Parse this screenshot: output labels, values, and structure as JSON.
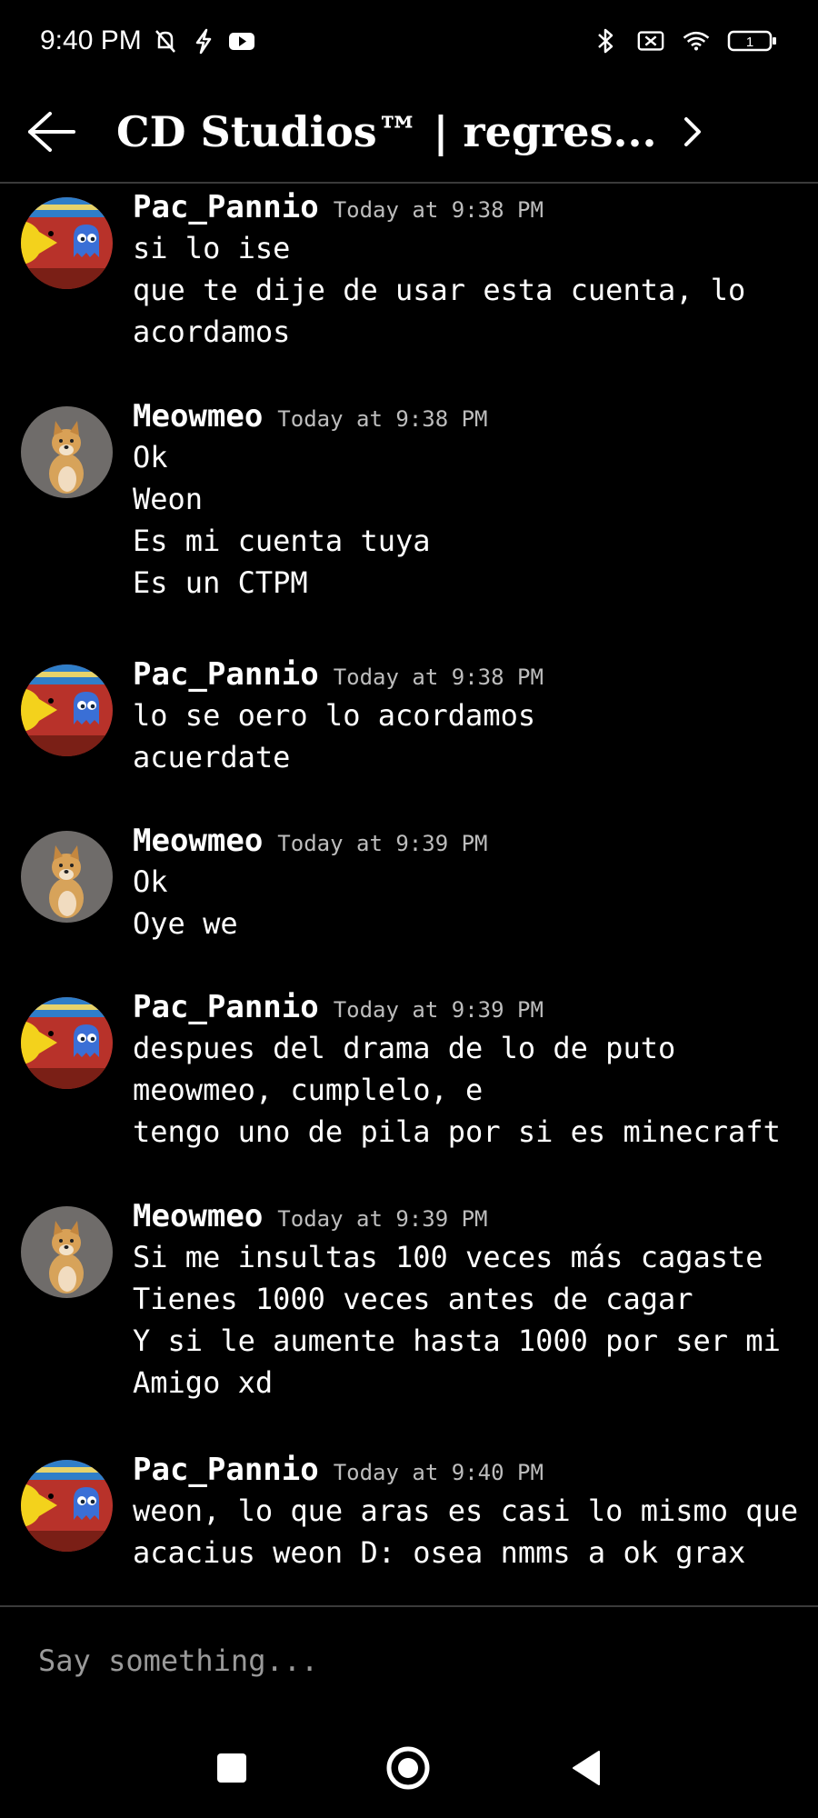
{
  "status_bar": {
    "time": "9:40 PM",
    "icons": [
      "mute-icon",
      "flash-icon",
      "youtube-icon",
      "bluetooth-icon",
      "sim-off-icon",
      "wifi-icon",
      "battery-icon"
    ],
    "battery_level": "1"
  },
  "header": {
    "title": "CD Studios™ | regres..."
  },
  "messages": [
    {
      "user": "Pac_Pannio",
      "time": "Today at 9:38 PM",
      "lines": [
        "si lo ise",
        "que te dije de usar esta cuenta, lo",
        "acordamos"
      ]
    },
    {
      "user": "Meowmeo",
      "time": "Today at 9:38 PM",
      "lines": [
        "Ok",
        "Weon",
        "Es mi cuenta tuya",
        "Es un CTPM"
      ]
    },
    {
      "user": "Pac_Pannio",
      "time": "Today at 9:38 PM",
      "lines": [
        "lo se oero lo acordamos",
        "acuerdate"
      ]
    },
    {
      "user": "Meowmeo",
      "time": "Today at 9:39 PM",
      "lines": [
        "Ok",
        "Oye we"
      ]
    },
    {
      "user": "Pac_Pannio",
      "time": "Today at 9:39 PM",
      "lines": [
        "despues del drama de lo de puto",
        "meowmeo, cumplelo, e",
        "tengo uno de pila por si es minecraft"
      ]
    },
    {
      "user": "Meowmeo",
      "time": "Today at 9:39 PM",
      "lines": [
        "Si me insultas 100 veces más cagaste",
        "Tienes 1000 veces antes de cagar",
        "Y si le aumente hasta 1000 por ser mi",
        "Amigo xd"
      ]
    },
    {
      "user": "Pac_Pannio",
      "time": "Today at 9:40 PM",
      "lines": [
        "weon, lo que aras es casi lo mismo que",
        "acacius weon D: osea nmms a ok grax"
      ]
    }
  ],
  "composer": {
    "placeholder": "Say something..."
  },
  "colors": {
    "background": "#000000",
    "text": "#ffffff",
    "timestamp": "#bdbdbd",
    "divider": "#3a3a3a"
  }
}
